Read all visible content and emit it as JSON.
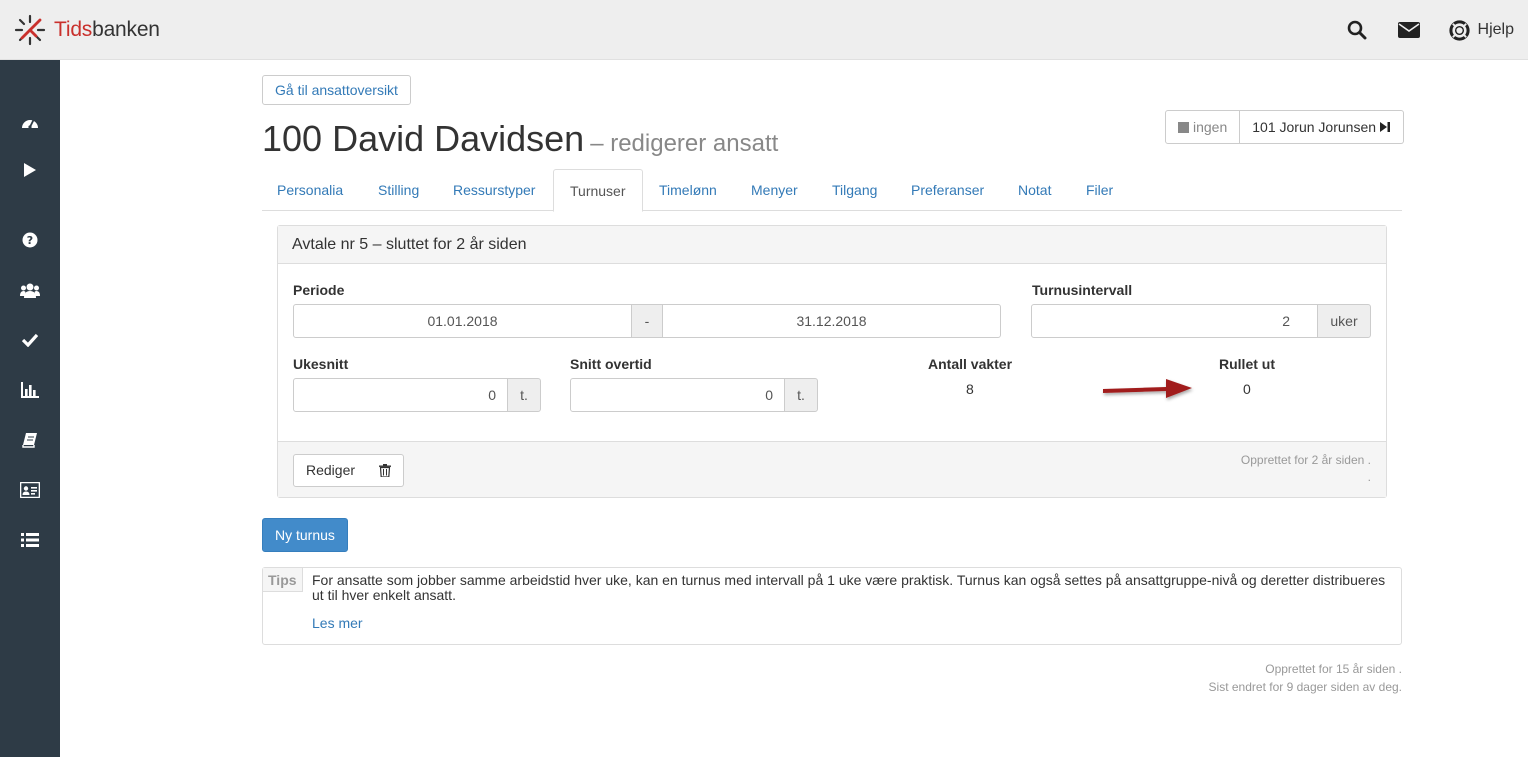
{
  "header": {
    "logo_part1": "Tids",
    "logo_part2": "banken",
    "help_label": "Hjelp"
  },
  "sidebar": {
    "icons": [
      "dashboard-icon",
      "play-icon",
      "question-icon",
      "users-icon",
      "check-icon",
      "bar-chart-icon",
      "book-icon",
      "id-card-icon",
      "list-icon"
    ]
  },
  "main": {
    "goto_button": "Gå til ansattoversikt",
    "title": "100 David Davidsen",
    "subtitle": "– redigerer ansatt",
    "prev_button": "ingen",
    "next_button": "101 Jorun Jorunsen"
  },
  "tabs": [
    {
      "label": "Personalia"
    },
    {
      "label": "Stilling"
    },
    {
      "label": "Ressurstyper"
    },
    {
      "label": "Turnuser"
    },
    {
      "label": "Timelønn"
    },
    {
      "label": "Menyer"
    },
    {
      "label": "Tilgang"
    },
    {
      "label": "Preferanser"
    },
    {
      "label": "Notat"
    },
    {
      "label": "Filer"
    }
  ],
  "active_tab": "Turnuser",
  "agreement": {
    "heading": "Avtale nr 5 – sluttet for 2 år siden",
    "periode_label": "Periode",
    "periode_from": "01.01.2018",
    "periode_sep": "-",
    "periode_to": "31.12.2018",
    "turnusintervall_label": "Turnusintervall",
    "turnusintervall_value": "2",
    "turnusintervall_unit": "uker",
    "ukesnitt_label": "Ukesnitt",
    "ukesnitt_value": "0",
    "ukesnitt_unit": "t.",
    "snitt_overtid_label": "Snitt overtid",
    "snitt_overtid_value": "0",
    "snitt_overtid_unit": "t.",
    "antall_vakter_label": "Antall vakter",
    "antall_vakter_value": "8",
    "rullet_ut_label": "Rullet ut",
    "rullet_ut_value": "0",
    "edit_button": "Rediger",
    "created_text": "Opprettet for 2 år siden .",
    "created_dot": "."
  },
  "new_button": "Ny turnus",
  "tips": {
    "label": "Tips",
    "text": "For ansatte som jobber samme arbeidstid hver uke, kan en turnus med intervall på 1 uke være praktisk. Turnus kan også settes på ansattgruppe-nivå og deretter distribueres ut til hver enkelt ansatt.",
    "link": "Les mer"
  },
  "footer": {
    "created": "Opprettet for 15 år siden .",
    "modified": "Sist endret for 9 dager siden av deg."
  },
  "colors": {
    "accent": "#337ab7",
    "primary_button": "#428bca",
    "sidebar": "#2e3b46",
    "logo_red": "#c9302c",
    "arrow": "#a11d1d"
  }
}
